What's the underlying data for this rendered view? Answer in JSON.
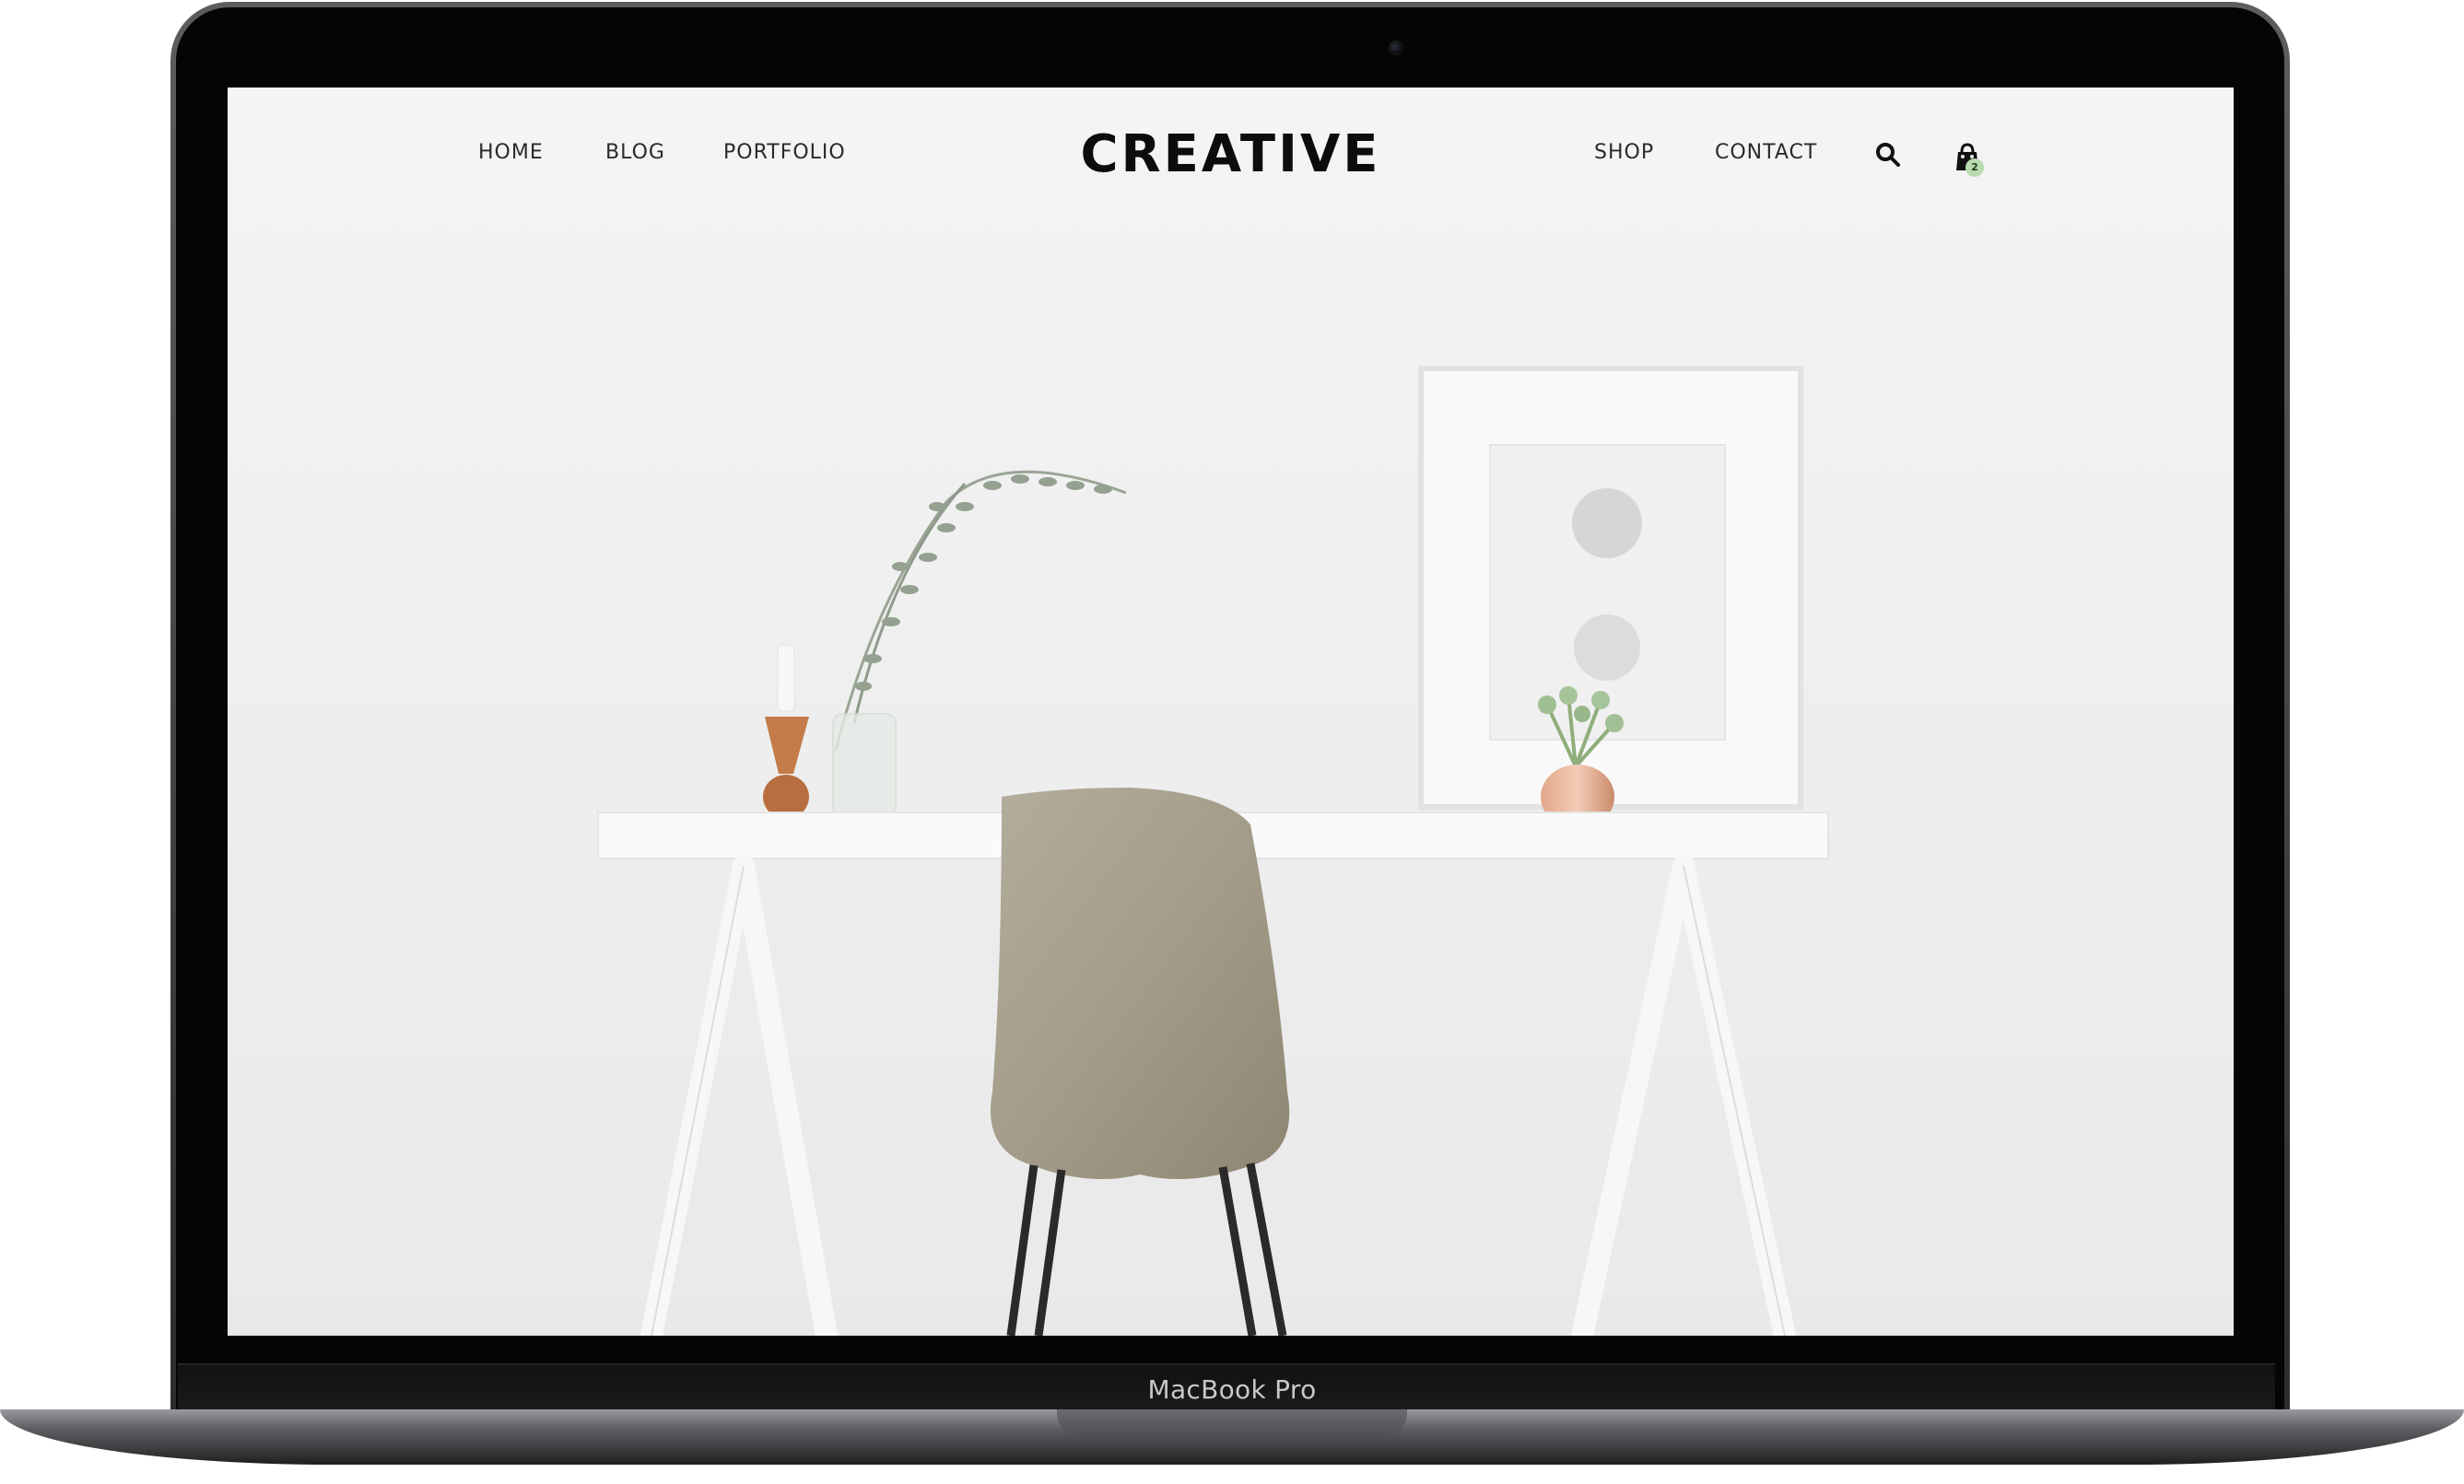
{
  "device": {
    "label": "MacBook Pro"
  },
  "header": {
    "logo": "CREATIVE",
    "nav_left": [
      {
        "label": "HOME"
      },
      {
        "label": "BLOG"
      },
      {
        "label": "PORTFOLIO"
      }
    ],
    "nav_right": [
      {
        "label": "SHOP"
      },
      {
        "label": "CONTACT"
      }
    ],
    "search_icon": "search-icon",
    "cart": {
      "icon": "shopping-bag-icon",
      "count": "2"
    }
  },
  "hero": {
    "scene": [
      "white-desk",
      "chair",
      "vase-with-eucalyptus",
      "candle-holder",
      "framed-art",
      "potted-plant"
    ]
  },
  "colors": {
    "page_bg": "#f0f0f0",
    "text": "#2a2a2a",
    "logo": "#0c0c0c",
    "cart_badge": "#b9dbb1",
    "chair": "#a59e8c"
  }
}
